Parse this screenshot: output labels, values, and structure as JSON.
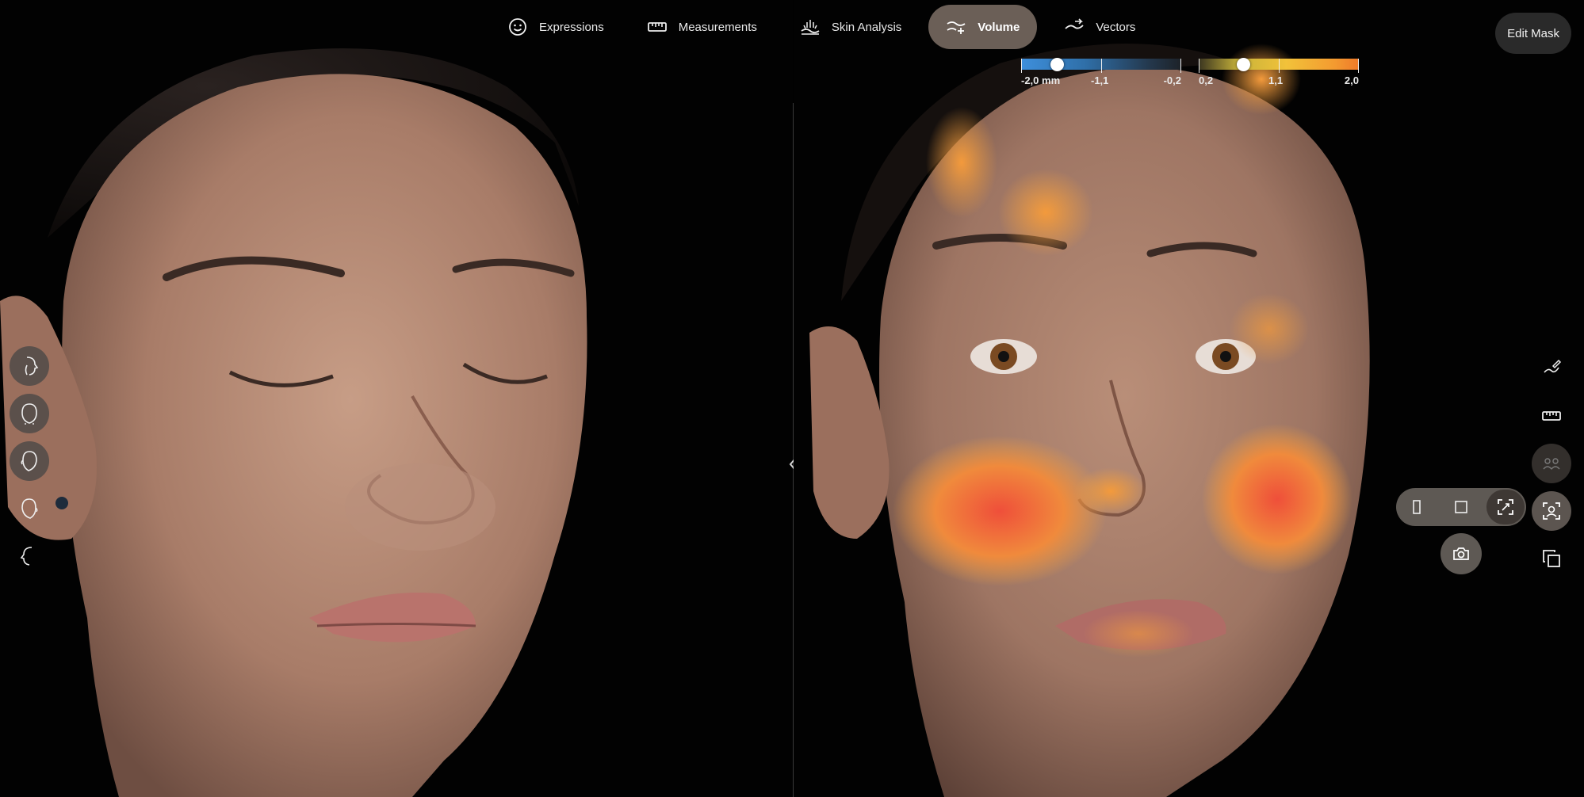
{
  "nav": {
    "tabs": [
      {
        "label": "Expressions",
        "icon": "smiley-icon",
        "active": false
      },
      {
        "label": "Measurements",
        "icon": "ruler-icon",
        "active": false
      },
      {
        "label": "Skin Analysis",
        "icon": "skin-analysis-icon",
        "active": false
      },
      {
        "label": "Volume",
        "icon": "volume-icon",
        "active": true
      },
      {
        "label": "Vectors",
        "icon": "vectors-icon",
        "active": false
      }
    ]
  },
  "edit_mask_label": "Edit Mask",
  "scale_negative": {
    "min_label": "-2,0 mm",
    "mid_label": "-1,1",
    "max_label": "-0,2",
    "knob_value": -1.6
  },
  "scale_positive": {
    "min_label": "0,2",
    "mid_label": "1,1",
    "max_label": "2,0",
    "knob_value": 0.7
  },
  "colors": {
    "accent_tab": "#6b5f57",
    "button_fill": "#5e5954",
    "heat_warm": "#f39a30",
    "heat_hot": "#ef5a3a",
    "heat_cool": "#3e8fdc"
  },
  "left_tools": [
    "face-right-profile-icon",
    "face-front-icon",
    "face-three-quarter-icon",
    "face-left-three-quarter-icon",
    "face-left-profile-icon"
  ],
  "right_tools": [
    "draw-icon",
    "ruler-icon",
    "compare-faces-icon",
    "face-scan-icon",
    "duplicate-icon"
  ],
  "layout_modes": [
    "single-portrait-icon",
    "single-square-icon",
    "fullscreen-icon"
  ],
  "active_layout": "fullscreen-icon"
}
